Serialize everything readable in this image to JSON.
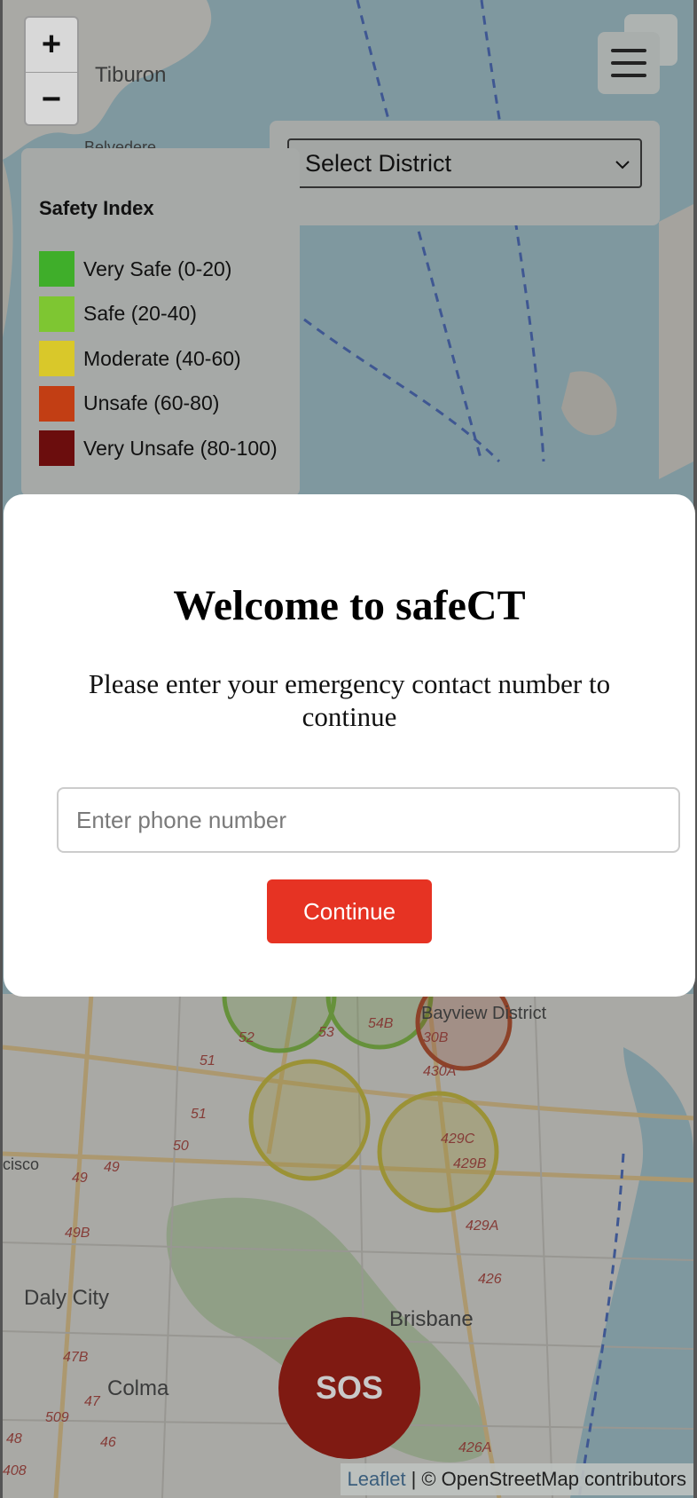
{
  "app": {
    "name": "safeCT"
  },
  "map": {
    "zoom_in_label": "+",
    "zoom_out_label": "−",
    "place_labels": [
      "Tiburon",
      "Belvedere",
      "Bayview District",
      "Daly City",
      "Colma",
      "Brisbane",
      "cisco"
    ],
    "route_labels": [
      "51",
      "51",
      "50",
      "49",
      "49",
      "49B",
      "47B",
      "47",
      "46",
      "509",
      "48",
      "408",
      "52",
      "53",
      "54B",
      "30B",
      "430A",
      "429C",
      "429B",
      "429A",
      "426",
      "426A"
    ],
    "attribution": {
      "leaflet": "Leaflet",
      "separator": "|",
      "osm": "© OpenStreetMap contributors"
    }
  },
  "menu": {
    "icon": "hamburger-menu-icon"
  },
  "district_select": {
    "selected": "Select District"
  },
  "legend": {
    "title": "Safety Index",
    "items": [
      {
        "label": "Very Safe (0-20)",
        "color": "#3fae2a"
      },
      {
        "label": "Safe (20-40)",
        "color": "#7ec632"
      },
      {
        "label": "Moderate (40-60)",
        "color": "#d9c82a"
      },
      {
        "label": "Unsafe (60-80)",
        "color": "#c23e14"
      },
      {
        "label": "Very Unsafe (80-100)",
        "color": "#6b0d0d"
      }
    ]
  },
  "modal": {
    "title": "Welcome to safeCT",
    "prompt": "Please enter your emergency contact number to continue",
    "phone_placeholder": "Enter phone number",
    "phone_value": "",
    "continue_label": "Continue"
  },
  "sos": {
    "label": "SOS",
    "color": "#e3261b"
  },
  "colors": {
    "accent": "#e63323",
    "water": "#aad3df"
  }
}
